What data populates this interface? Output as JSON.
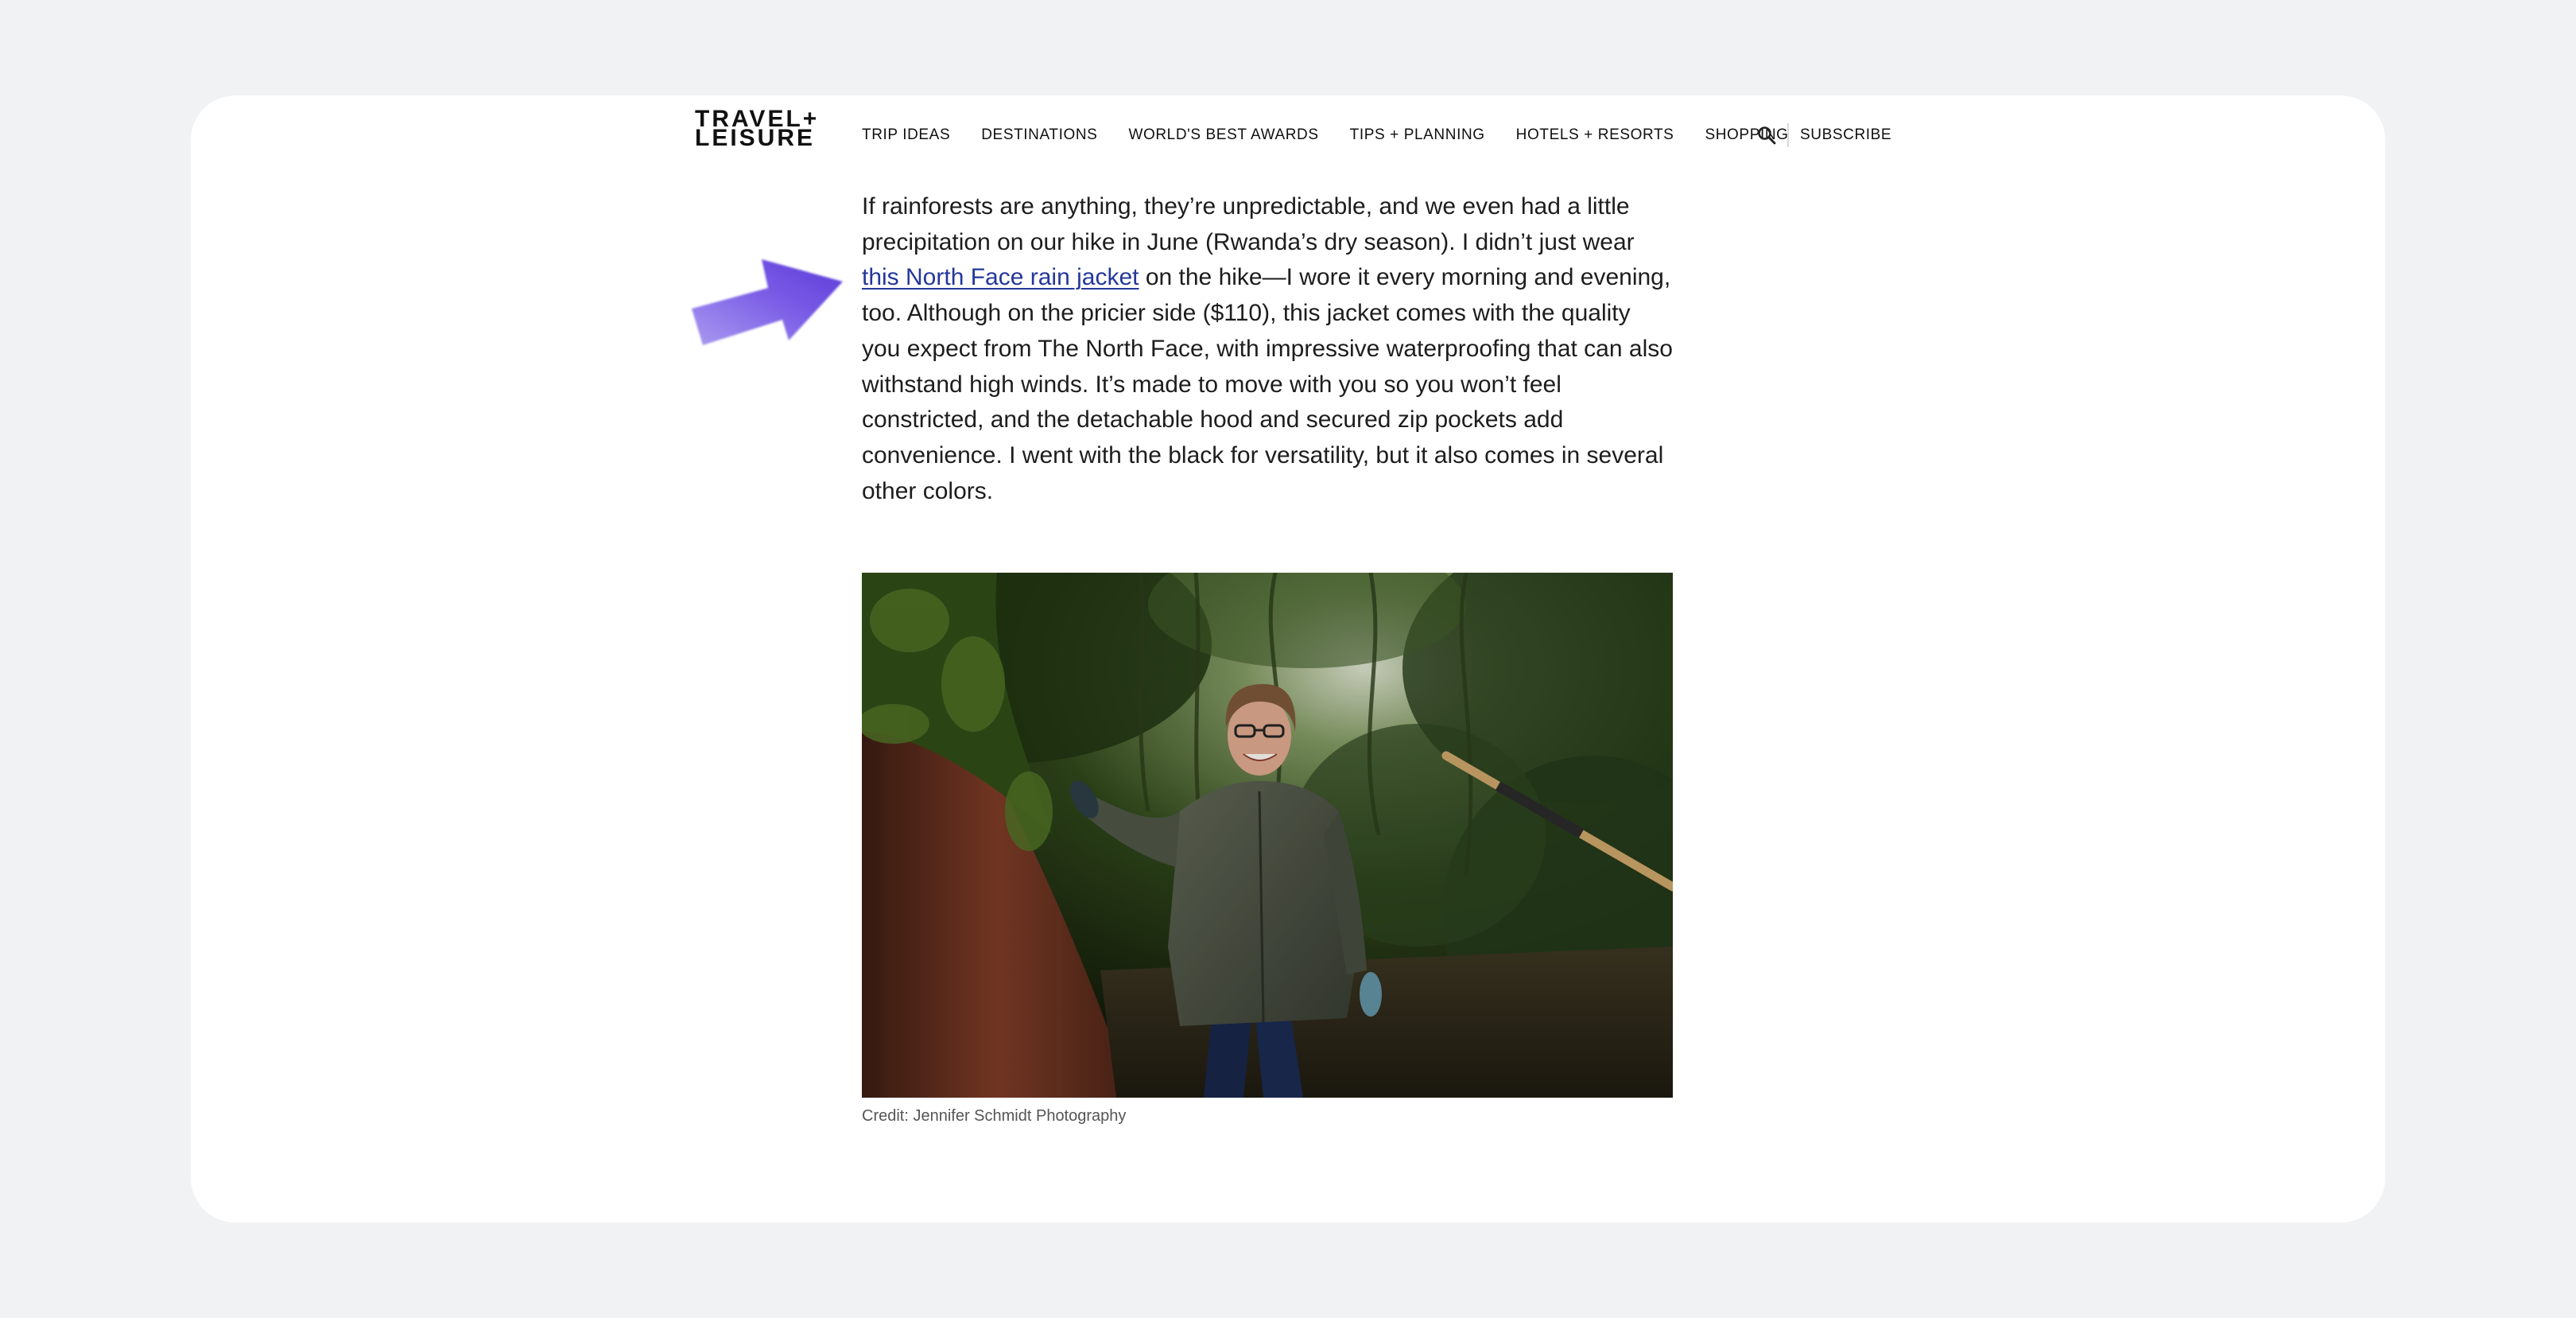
{
  "header": {
    "logo_line1": "TRAVEL+",
    "logo_line2": "LEISURE",
    "nav": [
      "TRIP IDEAS",
      "DESTINATIONS",
      "WORLD'S BEST AWARDS",
      "TIPS + PLANNING",
      "HOTELS + RESORTS",
      "SHOPPING"
    ],
    "search_icon": "search-icon",
    "subscribe": "SUBSCRIBE"
  },
  "article": {
    "para_part1": "If rainforests are anything, they’re unpredictable, and we even had a little precipitation on our hike in June (Rwanda’s dry season). I didn’t just wear ",
    "link_text": "this North Face rain jacket",
    "para_part2": " on the hike—I wore it every morning and evening, too. Although on the pricier side ($110), this jacket comes with the quality you expect from The North Face, with impressive waterproofing that can also withstand high winds. It’s made to move with you so you won’t feel constricted, and the detachable hood and secured zip pockets add convenience. I went with the black for versatility, but it also comes in several other colors.",
    "image_credit": "Credit: Jennifer Schmidt Photography"
  },
  "colors": {
    "page_bg": "#f1f2f3",
    "link": "#23379b",
    "arrow": "#6a4be0"
  }
}
